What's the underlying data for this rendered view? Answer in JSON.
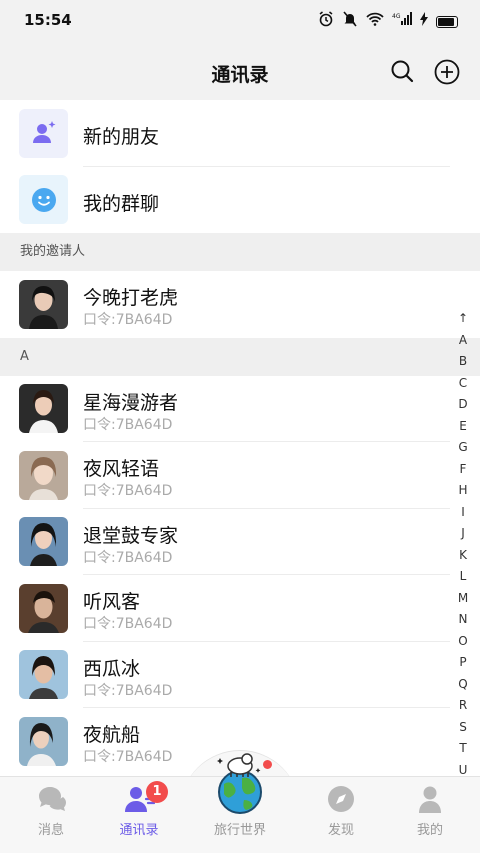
{
  "status": {
    "time": "15:54",
    "network": "4G"
  },
  "header": {
    "title": "通讯录",
    "search_icon": "search-icon",
    "add_icon": "add-circle-icon"
  },
  "top_items": [
    {
      "label": "新的朋友",
      "icon": "new-friend-icon",
      "color": "#7b6cf0"
    },
    {
      "label": "我的群聊",
      "icon": "group-chat-icon",
      "color": "#4aa8f0"
    }
  ],
  "sections": [
    {
      "title": "我的邀请人",
      "contacts": [
        {
          "name": "今晚打老虎",
          "code": "口令:7BA64D"
        }
      ]
    },
    {
      "title": "A",
      "contacts": [
        {
          "name": "星海漫游者",
          "code": "口令:7BA64D"
        },
        {
          "name": "夜风轻语",
          "code": "口令:7BA64D"
        },
        {
          "name": "退堂鼓专家",
          "code": "口令:7BA64D"
        },
        {
          "name": "听风客",
          "code": "口令:7BA64D"
        },
        {
          "name": "西瓜冰",
          "code": "口令:7BA64D"
        },
        {
          "name": "夜航船",
          "code": "口令:7BA64D"
        }
      ]
    }
  ],
  "index_letters": [
    "↑",
    "A",
    "B",
    "C",
    "D",
    "E",
    "G",
    "F",
    "H",
    "I",
    "J",
    "K",
    "L",
    "M",
    "N",
    "O",
    "P",
    "Q",
    "R",
    "S",
    "T",
    "U"
  ],
  "tabs": [
    {
      "label": "消息",
      "icon": "chat-bubble-icon",
      "active": false
    },
    {
      "label": "通讯录",
      "icon": "contacts-icon",
      "active": true,
      "badge": "1"
    },
    {
      "label": "旅行世界",
      "icon": "globe-icon",
      "active": false
    },
    {
      "label": "发现",
      "icon": "compass-icon",
      "active": false
    },
    {
      "label": "我的",
      "icon": "profile-icon",
      "active": false
    }
  ],
  "colors": {
    "accent": "#6c5ce7",
    "badge": "#f24c4c",
    "background": "#f2f2f2"
  }
}
